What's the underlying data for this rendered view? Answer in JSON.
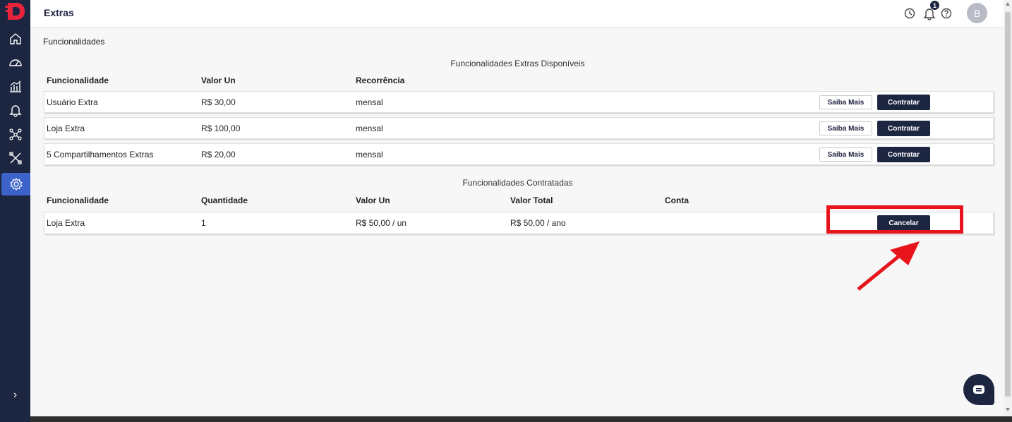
{
  "header": {
    "title": "Extras",
    "notification_count": "1",
    "avatar_initial": "B"
  },
  "sidebar": {
    "items": [
      {
        "icon": "home-icon"
      },
      {
        "icon": "dashboard-gauge-icon"
      },
      {
        "icon": "bar-chart-icon"
      },
      {
        "icon": "bell-icon"
      },
      {
        "icon": "network-icon"
      },
      {
        "icon": "tools-icon"
      },
      {
        "icon": "gear-icon",
        "active": true
      }
    ],
    "expand_label": "›"
  },
  "page": {
    "section_label": "Funcionalidades"
  },
  "available": {
    "title": "Funcionalidades Extras Disponíveis",
    "headers": [
      "Funcionalidade",
      "Valor Un",
      "Recorrência"
    ],
    "rows": [
      {
        "name": "Usuário Extra",
        "price": "R$ 30,00",
        "recurrence": "mensal",
        "info_label": "Saiba Mais",
        "hire_label": "Contratar"
      },
      {
        "name": "Loja Extra",
        "price": "R$ 100,00",
        "recurrence": "mensal",
        "info_label": "Saiba Mais",
        "hire_label": "Contratar"
      },
      {
        "name": "5 Compartilhamentos Extras",
        "price": "R$ 20,00",
        "recurrence": "mensal",
        "info_label": "Saiba Mais",
        "hire_label": "Contratar"
      }
    ]
  },
  "contracted": {
    "title": "Funcionalidades Contratadas",
    "headers": [
      "Funcionalidade",
      "Quantidade",
      "Valor Un",
      "Valor Total",
      "Conta"
    ],
    "rows": [
      {
        "name": "Loja Extra",
        "quantity": "1",
        "unit_price": "R$ 50,00 / un",
        "total": "R$ 50,00 / ano",
        "account": "",
        "cancel_label": "Cancelar"
      }
    ]
  },
  "colors": {
    "sidebar": "#1d2640",
    "accent": "#3b63c9",
    "annotation": "#e8141b",
    "button_dark": "#1d2640"
  }
}
